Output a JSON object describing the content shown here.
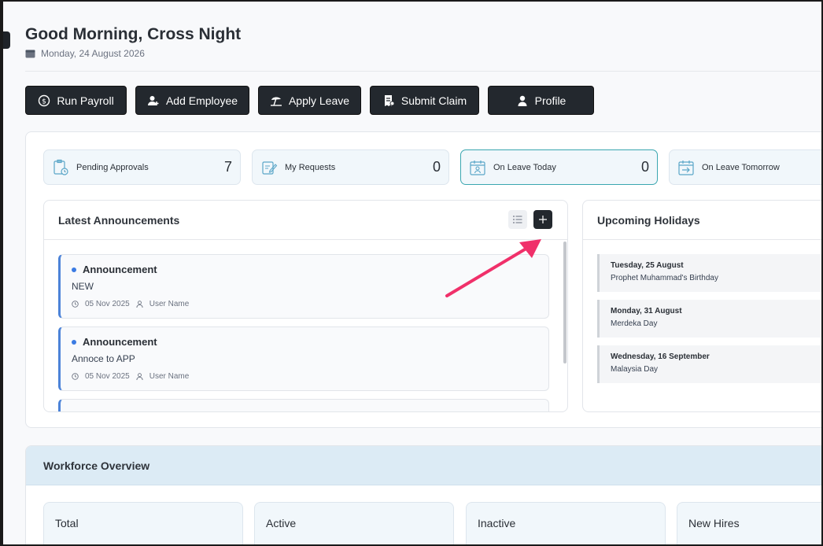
{
  "header": {
    "greeting": "Good Morning, Cross Night",
    "date": "Monday, 24 August 2026"
  },
  "actions": [
    {
      "label": "Run Payroll",
      "icon": "dollar-circle-icon"
    },
    {
      "label": "Add Employee",
      "icon": "user-plus-icon"
    },
    {
      "label": "Apply Leave",
      "icon": "beach-umbrella-icon"
    },
    {
      "label": "Submit Claim",
      "icon": "receipt-icon"
    },
    {
      "label": "Profile",
      "icon": "user-icon"
    }
  ],
  "stats": [
    {
      "label": "Pending Approvals",
      "value": "7",
      "icon": "clipboard-clock-icon"
    },
    {
      "label": "My Requests",
      "value": "0",
      "icon": "edit-note-icon"
    },
    {
      "label": "On Leave Today",
      "value": "0",
      "icon": "calendar-user-icon"
    },
    {
      "label": "On Leave Tomorrow",
      "value": "",
      "icon": "calendar-arrow-icon"
    }
  ],
  "announcements": {
    "title": "Latest Announcements",
    "items": [
      {
        "title": "Announcement",
        "body": "NEW",
        "date": "05 Nov 2025",
        "author": "User Name"
      },
      {
        "title": "Announcement",
        "body": "Annoce to APP",
        "date": "05 Nov 2025",
        "author": "User Name"
      }
    ]
  },
  "holidays": {
    "title": "Upcoming Holidays",
    "items": [
      {
        "date": "Tuesday, 25 August",
        "name": "Prophet Muhammad's Birthday"
      },
      {
        "date": "Monday, 31 August",
        "name": "Merdeka Day"
      },
      {
        "date": "Wednesday, 16 September",
        "name": "Malaysia Day"
      }
    ]
  },
  "workforce": {
    "title": "Workforce Overview",
    "boxes": [
      "Total",
      "Active",
      "Inactive",
      "New Hires"
    ]
  },
  "colors": {
    "accent": "#23282e",
    "highlight_arrow": "#f0306a",
    "announcement_border": "#4c83d8"
  }
}
